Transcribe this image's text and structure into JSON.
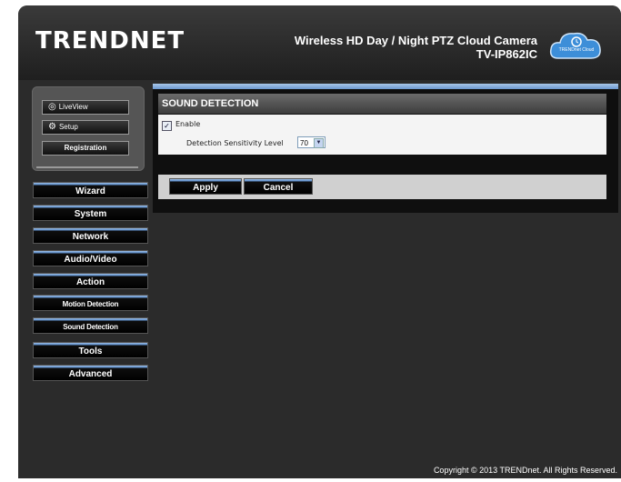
{
  "brand": {
    "logo": "TRENDNET",
    "product_title": "Wireless HD Day / Night PTZ Cloud Camera",
    "model": "TV-IP862IC",
    "cloud_label": "TRENDnet Cloud"
  },
  "quick_links": {
    "liveview": "LiveView",
    "setup": "Setup",
    "registration": "Registration"
  },
  "nav": [
    "Wizard",
    "System",
    "Network",
    "Audio/Video",
    "Action",
    "Motion Detection",
    "Sound Detection",
    "Tools",
    "Advanced"
  ],
  "section": {
    "title": "SOUND DETECTION",
    "enable_label": "Enable",
    "enable_checked": true,
    "sensitivity_label": "Detection Sensitivity Level",
    "sensitivity_value": "70"
  },
  "buttons": {
    "apply": "Apply",
    "cancel": "Cancel"
  },
  "footer": {
    "copyright": "Copyright © 2013 TRENDnet. All Rights Reserved."
  },
  "colors": {
    "background": "#2b2b2b",
    "nav_accent": "#5c8cc8",
    "panel": "#0f0f0f"
  },
  "icons": {
    "liveview": "eye-icon",
    "setup": "gear-icon",
    "select_arrow": "chevron-down-icon",
    "cloud": "cloud-icon"
  }
}
